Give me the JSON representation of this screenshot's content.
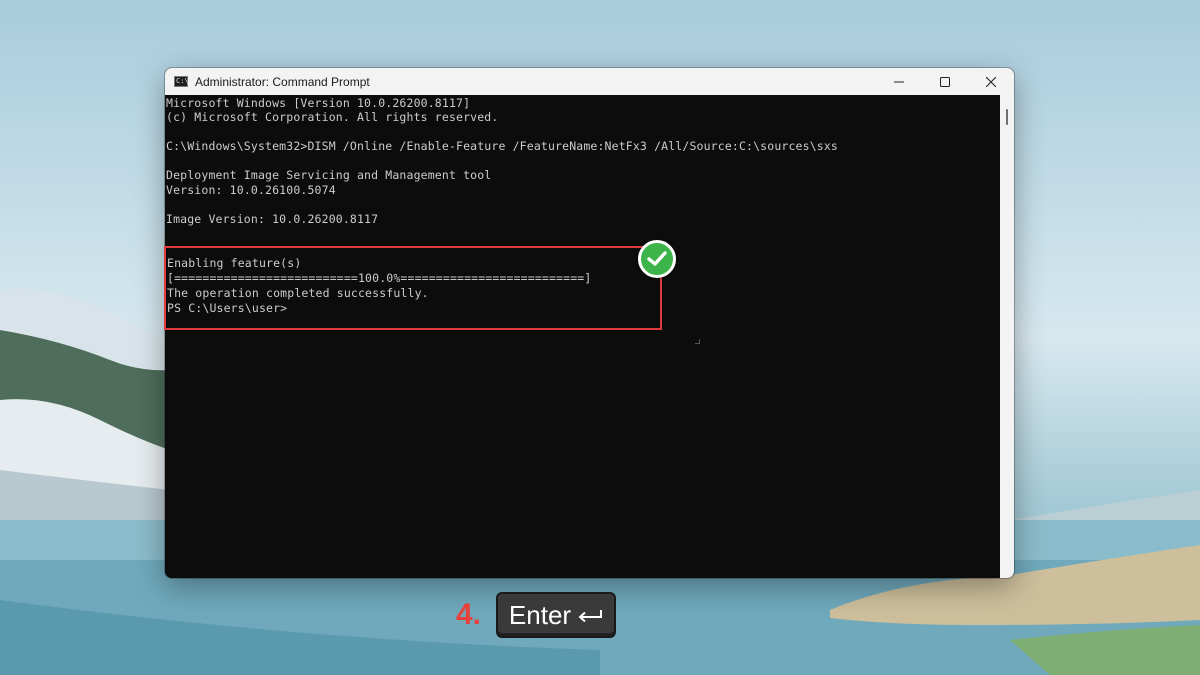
{
  "window": {
    "title": "Administrator: Command Prompt",
    "app_icon_glyph": "C:\\"
  },
  "console": {
    "lines": [
      "Microsoft Windows [Version 10.0.26200.8117]",
      "(c) Microsoft Corporation. All rights reserved.",
      "",
      "C:\\Windows\\System32>DISM /Online /Enable-Feature /FeatureName:NetFx3 /All/Source:C:\\sources\\sxs",
      "",
      "Deployment Image Servicing and Management tool",
      "Version: 10.0.26100.5074",
      "",
      "Image Version: 10.0.26200.8117",
      "",
      "",
      "Enabling feature(s)",
      "[==========================100.0%==========================]",
      "The operation completed successfully.",
      "PS C:\\Users\\user>"
    ]
  },
  "step": {
    "number": "4.",
    "key_label": "Enter",
    "key_icon": "return-arrow-icon"
  },
  "colors": {
    "highlight": "#e03a3a",
    "success": "#3cb44a",
    "step_number": "#e8413c"
  }
}
